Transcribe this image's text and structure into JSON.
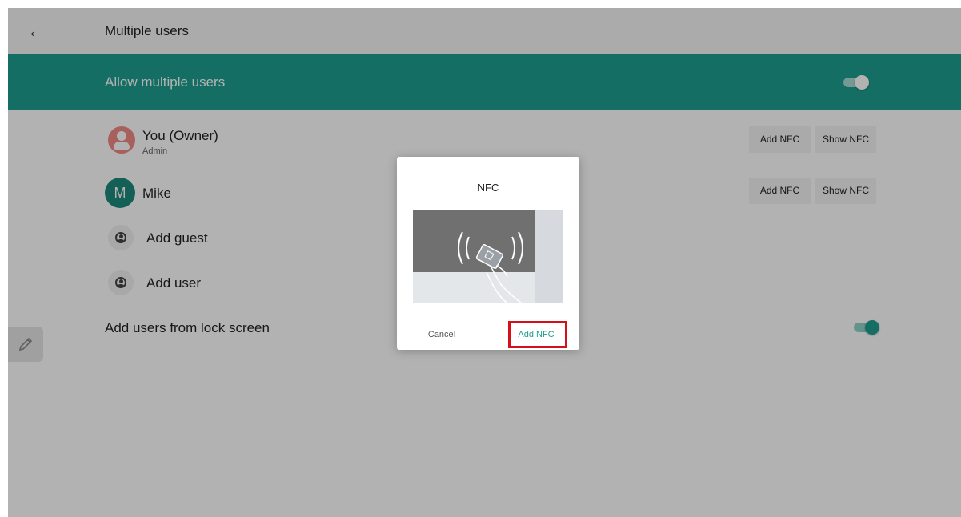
{
  "header": {
    "title": "Multiple users",
    "back_icon": "arrow-left-icon"
  },
  "banner": {
    "label": "Allow multiple users",
    "toggle_on": true
  },
  "users": [
    {
      "name": "You (Owner)",
      "subtitle": "Admin",
      "add_label": "Add NFC",
      "show_label": "Show NFC"
    },
    {
      "name": "Mike",
      "initial": "M",
      "add_label": "Add NFC",
      "show_label": "Show NFC"
    }
  ],
  "actions": {
    "add_guest": "Add guest",
    "add_user": "Add user"
  },
  "lock_screen": {
    "label": "Add users from lock screen",
    "toggle_on": true
  },
  "dialog": {
    "title": "NFC",
    "cancel_label": "Cancel",
    "confirm_label": "Add NFC"
  },
  "colors": {
    "accent": "#1f9e8e",
    "owner_avatar": "#ef8a85",
    "highlight": "#d6101b"
  }
}
